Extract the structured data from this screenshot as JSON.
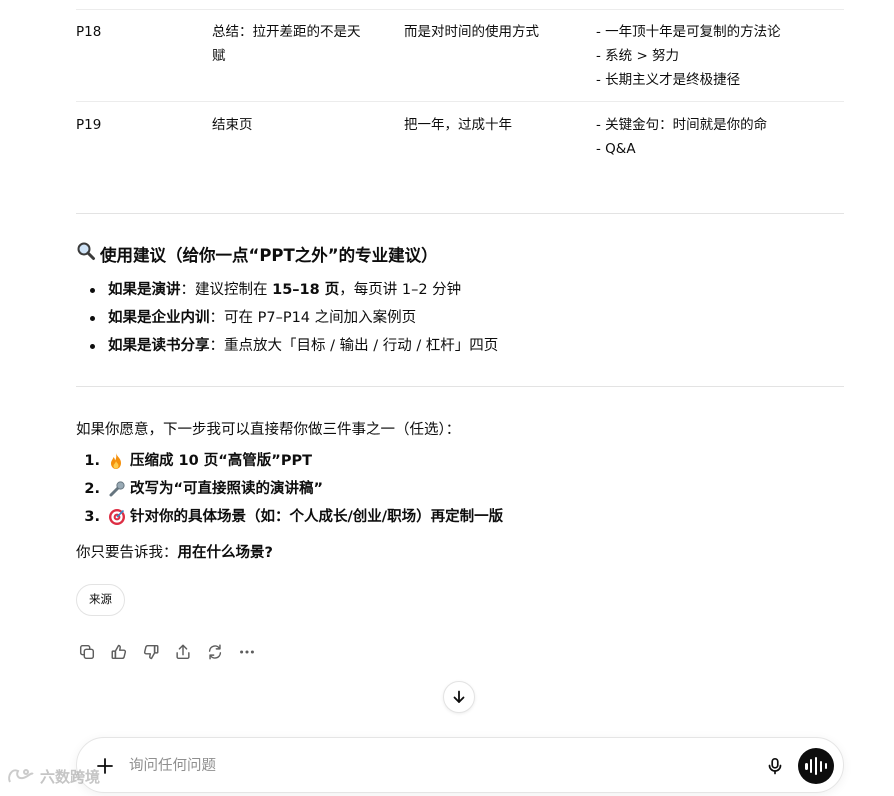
{
  "table": {
    "rows": [
      {
        "page": "P18",
        "title_lines": [
          "总结：拉开差距的不是天",
          "赋"
        ],
        "subtitle": "而是对时间的使用方式",
        "points": [
          "- 一年顶十年是可复制的方法论",
          "- 系统 > 努力",
          "- 长期主义才是终极捷径"
        ]
      },
      {
        "page": "P19",
        "title_lines": [
          "结束页"
        ],
        "subtitle": "把一年，过成十年",
        "points": [
          "- 关键金句：时间就是你的命",
          "- Q&A"
        ]
      }
    ]
  },
  "suggestions": {
    "heading_icon": "magnifier-icon",
    "heading": "使用建议（给你一点“PPT之外”的专业建议）",
    "items": [
      {
        "lead": "如果是演讲",
        "pre": "：建议控制在 ",
        "bold": "15–18 页",
        "post": "，每页讲 1–2 分钟"
      },
      {
        "lead": "如果是企业内训",
        "pre": "：可在 P7–P14 之间加入案例页",
        "bold": "",
        "post": ""
      },
      {
        "lead": "如果是读书分享",
        "pre": "：重点放大「目标 / 输出 / 行动 / 杠杆」四页",
        "bold": "",
        "post": ""
      }
    ]
  },
  "offer": {
    "intro": "如果你愿意，下一步我可以直接帮你做三件事之一（任选）：",
    "options": [
      {
        "num": "1.",
        "icon": "fire-icon",
        "text": "压缩成 10 页“高管版”PPT"
      },
      {
        "num": "2.",
        "icon": "microphone-icon",
        "text": "改写为“可直接照读的演讲稿”"
      },
      {
        "num": "3.",
        "icon": "target-icon",
        "text": "针对你的具体场景（如：个人成长/创业/职场）再定制一版"
      }
    ],
    "ask_prefix": "你只要告诉我：",
    "ask_bold": "用在什么场景?"
  },
  "source_chip": "来源",
  "actions": [
    "copy-icon",
    "thumbs-up-icon",
    "thumbs-down-icon",
    "share-icon",
    "regenerate-icon",
    "more-icon"
  ],
  "composer": {
    "placeholder": "询问任何问题"
  },
  "watermark": "六数跨境",
  "colors": {
    "text": "#0d0d0d",
    "border": "#e3e3e3",
    "muted_icon": "#5d5d5d",
    "voice_button": "#0d0d0d"
  }
}
